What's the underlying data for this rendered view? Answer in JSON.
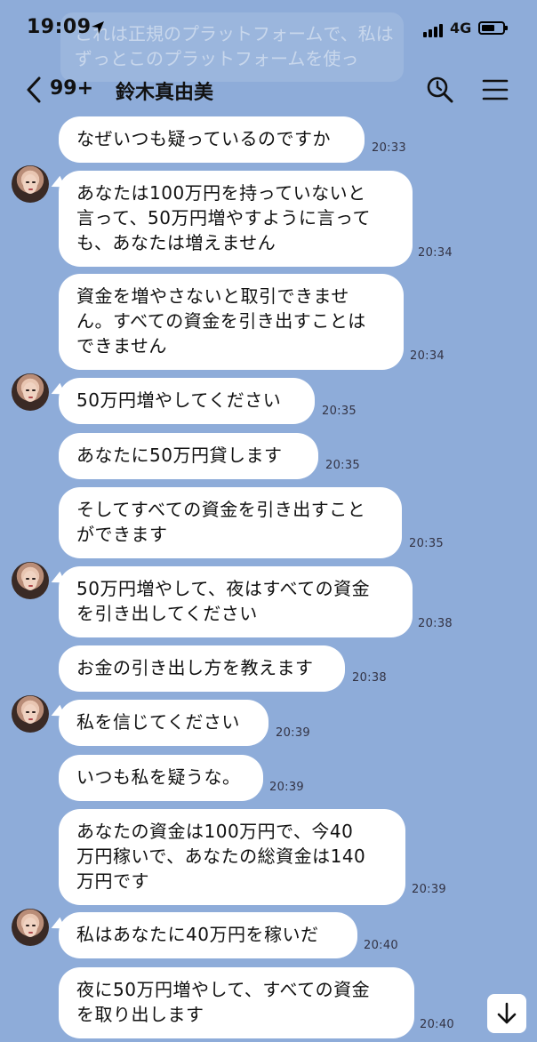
{
  "status_bar": {
    "time": "19:09",
    "network": "4G"
  },
  "ghost_banner": {
    "text": "これは正規のプラットフォームで、私はずっとこのプラットフォームを使っ"
  },
  "header": {
    "back_count": "99+",
    "title": "鈴木真由美"
  },
  "messages": [
    {
      "text": "なぜいつも疑っているのですか",
      "time": "20:33"
    },
    {
      "text": "あなたは100万円を持っていないと\n言って、50万円増やすように言って\nも、あなたは増えません",
      "time": "20:34"
    },
    {
      "text": "資金を増やさないと取引できませ\nん。すべての資金を引き出すことは\nできません",
      "time": "20:34"
    },
    {
      "text": "50万円増やしてください",
      "time": "20:35"
    },
    {
      "text": "あなたに50万円貸します",
      "time": "20:35"
    },
    {
      "text": "そしてすべての資金を引き出すこと\nができます",
      "time": "20:35"
    },
    {
      "text": "50万円増やして、夜はすべての資金\nを引き出してください",
      "time": "20:38"
    },
    {
      "text": "お金の引き出し方を教えます",
      "time": "20:38"
    },
    {
      "text": "私を信じてください",
      "time": "20:39"
    },
    {
      "text": "いつも私を疑うな。",
      "time": "20:39"
    },
    {
      "text": "あなたの資金は100万円で、今40\n万円稼いで、あなたの総資金は140\n万円です",
      "time": "20:39"
    },
    {
      "text": "私はあなたに40万円を稼いだ",
      "time": "20:40"
    },
    {
      "text": "夜に50万円増やして、すべての資金\nを取り出します",
      "time": "20:40"
    }
  ],
  "icons": {
    "back": "chevron-left-icon",
    "search": "search-clock-icon",
    "menu": "hamburger-menu-icon",
    "scroll": "arrow-down-icon",
    "location": "location-arrow-icon"
  },
  "colors": {
    "background": "#8eacd9",
    "bubble": "#ffffff"
  }
}
